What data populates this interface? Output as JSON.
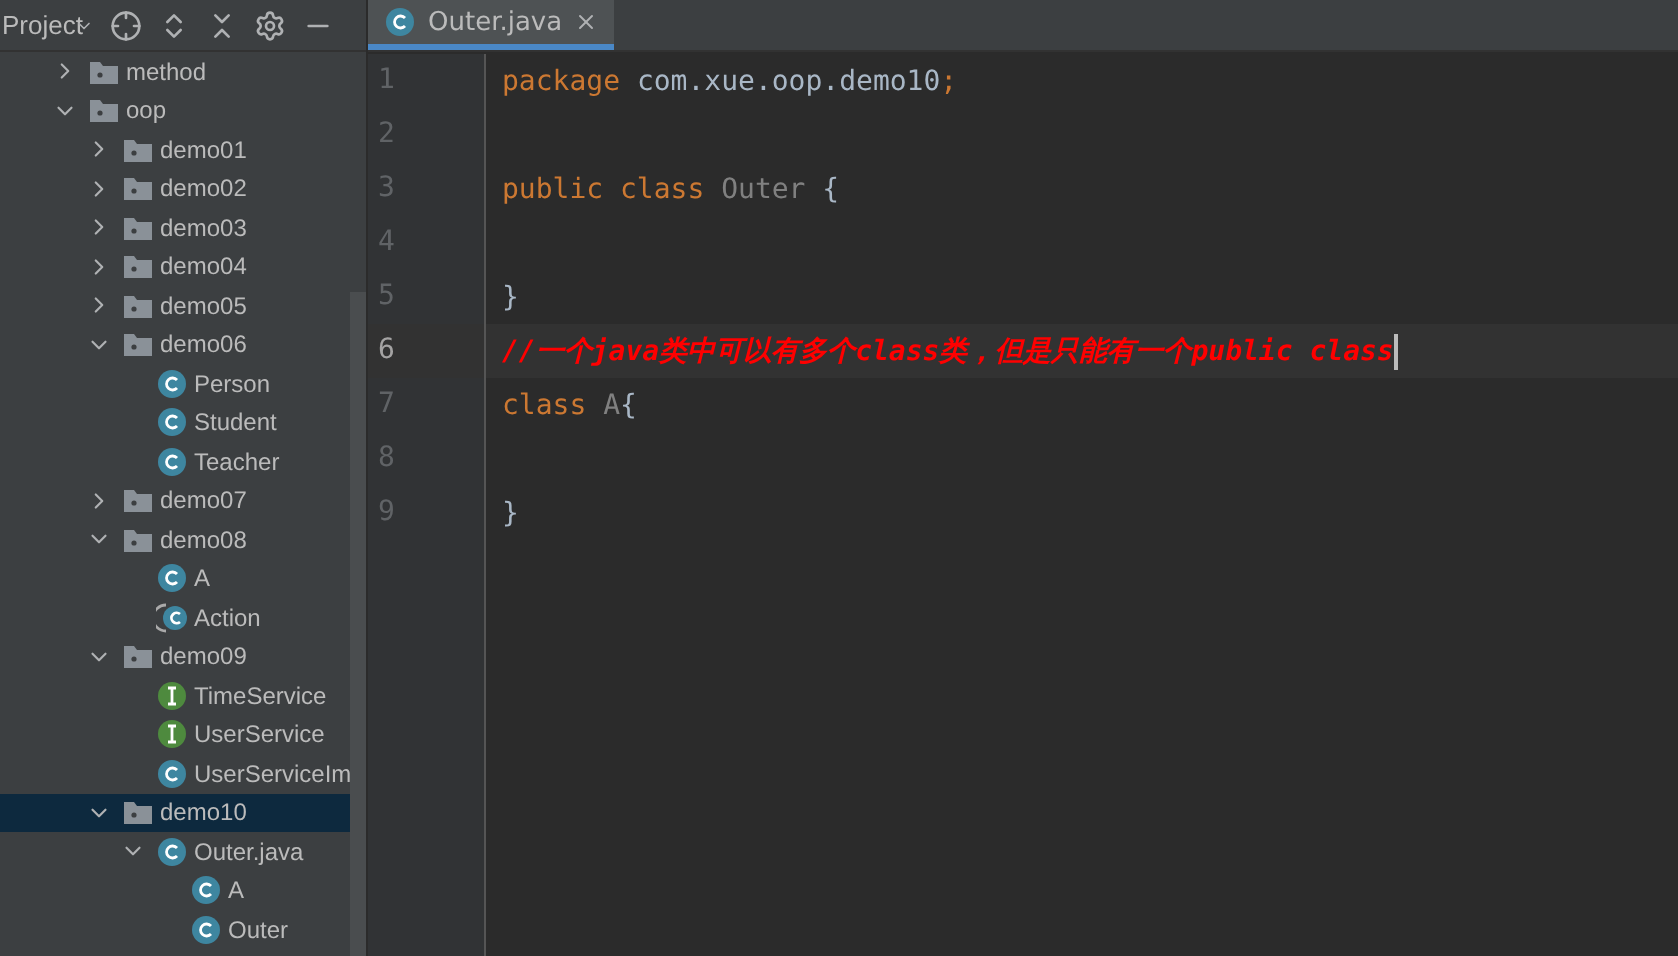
{
  "project_panel": {
    "title": "Project",
    "tree": [
      {
        "label": "method",
        "kind": "folder",
        "expanded": false,
        "selected": false
      },
      {
        "label": "oop",
        "kind": "folder",
        "expanded": true,
        "selected": false,
        "children": [
          {
            "label": "demo01",
            "kind": "folder",
            "expanded": false,
            "selected": false
          },
          {
            "label": "demo02",
            "kind": "folder",
            "expanded": false,
            "selected": false
          },
          {
            "label": "demo03",
            "kind": "folder",
            "expanded": false,
            "selected": false
          },
          {
            "label": "demo04",
            "kind": "folder",
            "expanded": false,
            "selected": false
          },
          {
            "label": "demo05",
            "kind": "folder",
            "expanded": false,
            "selected": false
          },
          {
            "label": "demo06",
            "kind": "folder",
            "expanded": true,
            "selected": false,
            "children": [
              {
                "label": "Person",
                "kind": "class",
                "selected": false
              },
              {
                "label": "Student",
                "kind": "class",
                "selected": false
              },
              {
                "label": "Teacher",
                "kind": "class",
                "selected": false
              }
            ]
          },
          {
            "label": "demo07",
            "kind": "folder",
            "expanded": false,
            "selected": false
          },
          {
            "label": "demo08",
            "kind": "folder",
            "expanded": true,
            "selected": false,
            "children": [
              {
                "label": "A",
                "kind": "class",
                "selected": false
              },
              {
                "label": "Action",
                "kind": "abstract",
                "selected": false
              }
            ]
          },
          {
            "label": "demo09",
            "kind": "folder",
            "expanded": true,
            "selected": false,
            "children": [
              {
                "label": "TimeService",
                "kind": "interface",
                "selected": false
              },
              {
                "label": "UserService",
                "kind": "interface",
                "selected": false
              },
              {
                "label": "UserServiceIm",
                "kind": "class",
                "selected": false
              }
            ]
          },
          {
            "label": "demo10",
            "kind": "folder",
            "expanded": true,
            "selected": true,
            "children": [
              {
                "label": "Outer.java",
                "kind": "file",
                "expanded": true,
                "selected": false,
                "children": [
                  {
                    "label": "A",
                    "kind": "class",
                    "selected": false
                  },
                  {
                    "label": "Outer",
                    "kind": "class",
                    "selected": false
                  }
                ]
              }
            ]
          }
        ]
      }
    ]
  },
  "editor": {
    "tabs": [
      {
        "label": "Outer.java",
        "selected": true
      }
    ],
    "lines": [
      {
        "number": "1",
        "current": false,
        "tokens": [
          {
            "text": "package",
            "kind": "keyword"
          },
          {
            "text": " com.xue.oop.demo10",
            "kind": "plain"
          },
          {
            "text": ";",
            "kind": "keyword"
          }
        ]
      },
      {
        "number": "2",
        "current": false
      },
      {
        "number": "3",
        "current": false,
        "tokens": [
          {
            "text": "public class",
            "kind": "keyword"
          },
          {
            "text": " Outer",
            "kind": "classname"
          },
          {
            "text": " {",
            "kind": "plain"
          }
        ]
      },
      {
        "number": "4",
        "current": false
      },
      {
        "number": "5",
        "current": false,
        "tokens": [
          {
            "text": "}",
            "kind": "plain"
          }
        ]
      },
      {
        "number": "6",
        "current": true,
        "tokens": [
          {
            "text": "//一个java类中可以有多个class类，但是只能有一个public class",
            "kind": "comment"
          }
        ]
      },
      {
        "number": "7",
        "current": false,
        "tokens": [
          {
            "text": "class",
            "kind": "keyword"
          },
          {
            "text": " A",
            "kind": "classname"
          },
          {
            "text": "{",
            "kind": "plain"
          }
        ]
      },
      {
        "number": "8",
        "current": false
      },
      {
        "number": "9",
        "current": false,
        "tokens": [
          {
            "text": "}",
            "kind": "plain"
          }
        ]
      }
    ]
  }
}
